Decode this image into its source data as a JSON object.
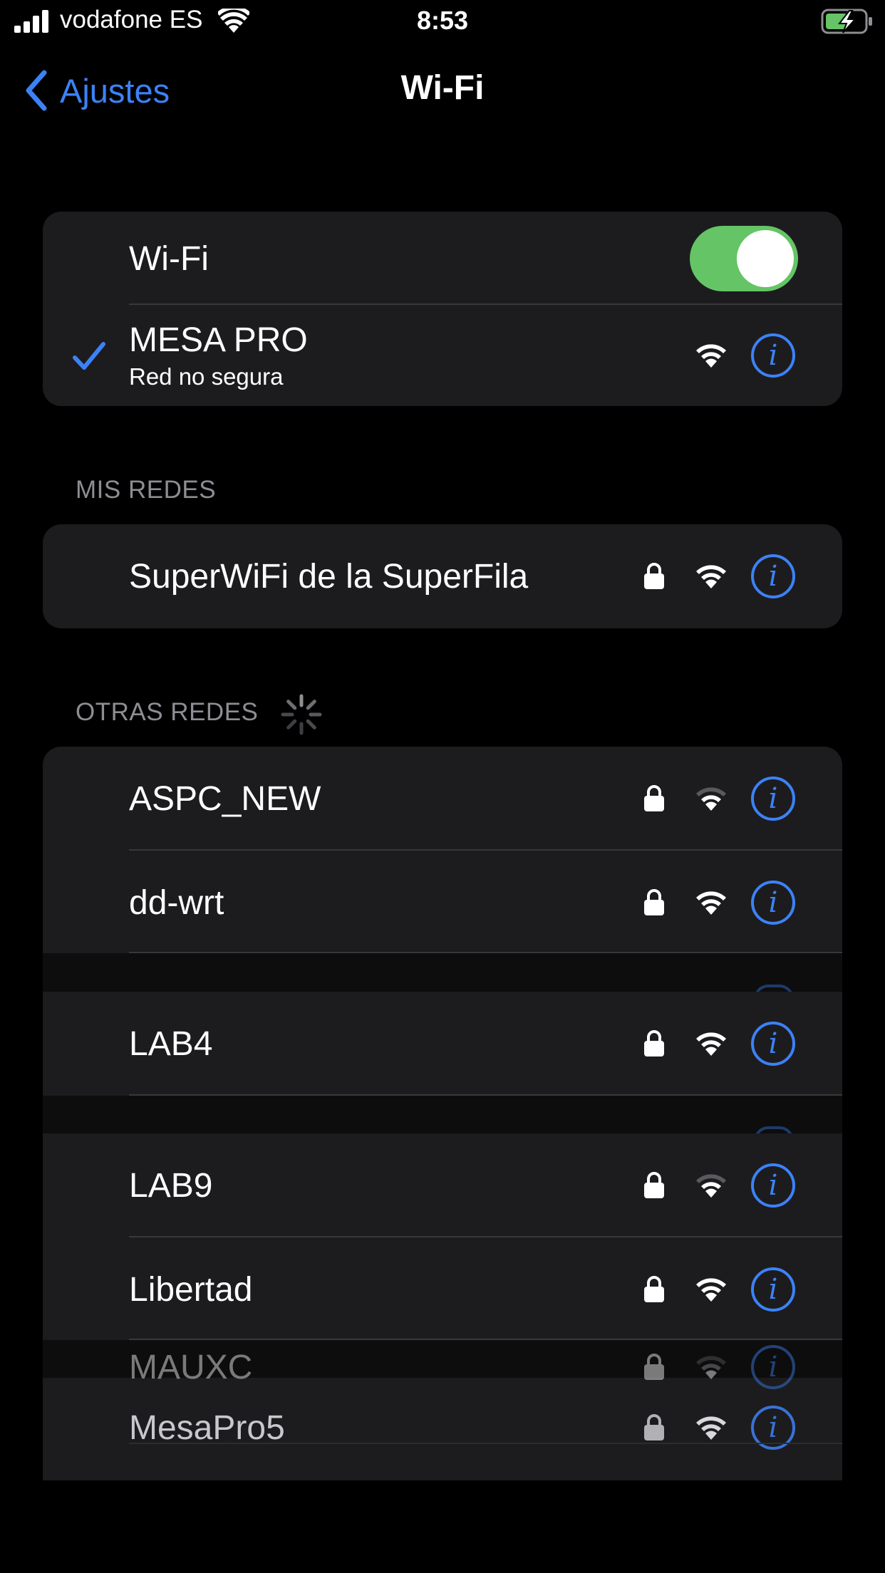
{
  "status_bar": {
    "carrier": "vodafone ES",
    "time": "8:53",
    "battery_state": "charging"
  },
  "nav": {
    "back_label": "Ajustes",
    "title": "Wi-Fi"
  },
  "wifi_toggle": {
    "label": "Wi-Fi",
    "on": true
  },
  "connected_network": {
    "name": "MESA PRO",
    "subtitle": "Red no segura"
  },
  "my_networks": {
    "header": "MIS REDES",
    "items": [
      {
        "name": "SuperWiFi de la SuperFila",
        "locked": true
      }
    ]
  },
  "other_networks": {
    "header": "OTRAS REDES",
    "items": [
      {
        "name": "ASPC_NEW",
        "locked": true,
        "signal": "medium"
      },
      {
        "name": "dd-wrt",
        "locked": true,
        "signal": "full"
      },
      {
        "name": "LAB4",
        "locked": true,
        "signal": "full"
      },
      {
        "name": "LAB9",
        "locked": true,
        "signal": "medium"
      },
      {
        "name": "Libertad",
        "locked": true,
        "signal": "full"
      },
      {
        "name": "MAUXC",
        "locked": true,
        "signal": "low"
      },
      {
        "name": "MesaPro5",
        "locked": true,
        "signal": "full"
      }
    ]
  },
  "colors": {
    "accent": "#3c82f6",
    "toggle_on": "#65c466",
    "cell_background": "#1c1c1e",
    "section_header": "#8d8d93"
  },
  "icons": {
    "back": "chevron-left-icon",
    "check": "checkmark-icon",
    "lock": "lock-icon",
    "wifi": "wifi-signal-icon",
    "info": "info-circle-icon",
    "spinner": "activity-spinner-icon"
  }
}
